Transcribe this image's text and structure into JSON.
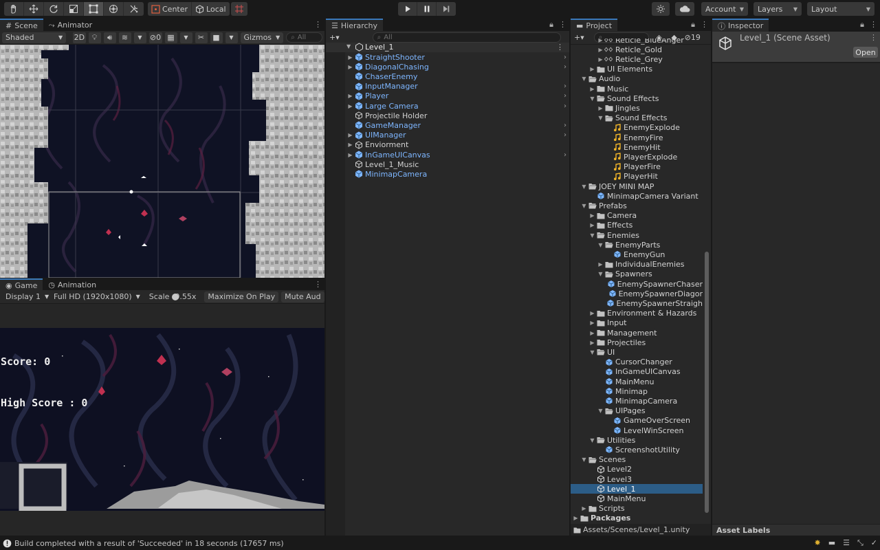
{
  "toolbar": {
    "pivot_label": "Center",
    "space_label": "Local",
    "account_label": "Account",
    "layers_label": "Layers",
    "layout_label": "Layout"
  },
  "scene_panel": {
    "tabs": [
      {
        "label": "Scene"
      },
      {
        "label": "Animator"
      }
    ],
    "shading_mode": "Shaded",
    "toggle_2d": "2D",
    "hidden_count": "0",
    "gizmos_label": "Gizmos",
    "search_placeholder": "All"
  },
  "game_panel": {
    "tabs": [
      {
        "label": "Game"
      },
      {
        "label": "Animation"
      }
    ],
    "display": "Display 1",
    "resolution": "Full HD (1920x1080)",
    "scale_label": "Scale",
    "scale_value": "0.55x",
    "maximize_label": "Maximize On Play",
    "mute_label": "Mute Aud",
    "score_text": "Score: 0",
    "high_score_text": "High Score : 0"
  },
  "hierarchy": {
    "tab_label": "Hierarchy",
    "search_placeholder": "All",
    "scene_name": "Level_1",
    "items": [
      {
        "label": "StraightShooter",
        "type": "prefab",
        "expandable": true
      },
      {
        "label": "DiagonalChasing",
        "type": "prefab",
        "expandable": true
      },
      {
        "label": "ChaserEnemy",
        "type": "prefab",
        "expandable": false
      },
      {
        "label": "InputManager",
        "type": "prefab",
        "expandable": false
      },
      {
        "label": "Player",
        "type": "prefab",
        "expandable": true
      },
      {
        "label": "Large Camera",
        "type": "prefab",
        "expandable": true
      },
      {
        "label": "Projectile Holder",
        "type": "object",
        "expandable": false
      },
      {
        "label": "GameManager",
        "type": "prefab",
        "expandable": false
      },
      {
        "label": "UIManager",
        "type": "prefab",
        "expandable": true
      },
      {
        "label": "Enviorment",
        "type": "object",
        "expandable": true
      },
      {
        "label": "InGameUICanvas",
        "type": "prefab",
        "expandable": true
      },
      {
        "label": "Level_1_Music",
        "type": "object",
        "expandable": false
      },
      {
        "label": "MinimapCamera",
        "type": "prefab",
        "expandable": false
      }
    ]
  },
  "project": {
    "tab_label": "Project",
    "hidden_packages_count": "19",
    "path": "Assets/Scenes/Level_1.unity",
    "items": [
      {
        "label": "Reticle_BlueAnger",
        "depth": 2,
        "icon": "sprite",
        "fold": "closed"
      },
      {
        "label": "Reticle_Gold",
        "depth": 2,
        "icon": "sprite",
        "fold": "closed"
      },
      {
        "label": "Reticle_Grey",
        "depth": 2,
        "icon": "sprite",
        "fold": "closed"
      },
      {
        "label": "UI Elements",
        "depth": 1,
        "icon": "folder",
        "fold": "closed"
      },
      {
        "label": "Audio",
        "depth": 0,
        "icon": "folder-open",
        "fold": "open"
      },
      {
        "label": "Music",
        "depth": 1,
        "icon": "folder",
        "fold": "closed"
      },
      {
        "label": "Sound Effects",
        "depth": 1,
        "icon": "folder-open",
        "fold": "open"
      },
      {
        "label": "Jingles",
        "depth": 2,
        "icon": "folder",
        "fold": "closed"
      },
      {
        "label": "Sound Effects",
        "depth": 2,
        "icon": "folder-open",
        "fold": "open"
      },
      {
        "label": "EnemyExplode",
        "depth": 3,
        "icon": "audio",
        "fold": "none"
      },
      {
        "label": "EnemyFire",
        "depth": 3,
        "icon": "audio",
        "fold": "none"
      },
      {
        "label": "EnemyHit",
        "depth": 3,
        "icon": "audio",
        "fold": "none"
      },
      {
        "label": "PlayerExplode",
        "depth": 3,
        "icon": "audio",
        "fold": "none"
      },
      {
        "label": "PlayerFire",
        "depth": 3,
        "icon": "audio",
        "fold": "none"
      },
      {
        "label": "PlayerHit",
        "depth": 3,
        "icon": "audio",
        "fold": "none"
      },
      {
        "label": "JOEY MINI MAP",
        "depth": 0,
        "icon": "folder-open",
        "fold": "open"
      },
      {
        "label": "MinimapCamera Variant",
        "depth": 1,
        "icon": "prefab",
        "fold": "none"
      },
      {
        "label": "Prefabs",
        "depth": 0,
        "icon": "folder-open",
        "fold": "open"
      },
      {
        "label": "Camera",
        "depth": 1,
        "icon": "folder",
        "fold": "closed"
      },
      {
        "label": "Effects",
        "depth": 1,
        "icon": "folder",
        "fold": "closed"
      },
      {
        "label": "Enemies",
        "depth": 1,
        "icon": "folder-open",
        "fold": "open"
      },
      {
        "label": "EnemyParts",
        "depth": 2,
        "icon": "folder-open",
        "fold": "open"
      },
      {
        "label": "EnemyGun",
        "depth": 3,
        "icon": "prefab",
        "fold": "none"
      },
      {
        "label": "IndividualEnemies",
        "depth": 2,
        "icon": "folder",
        "fold": "closed"
      },
      {
        "label": "Spawners",
        "depth": 2,
        "icon": "folder-open",
        "fold": "open"
      },
      {
        "label": "EnemySpawnerChaser",
        "depth": 3,
        "icon": "prefab",
        "fold": "none"
      },
      {
        "label": "EnemySpawnerDiagor",
        "depth": 3,
        "icon": "prefab",
        "fold": "none"
      },
      {
        "label": "EnemySpawnerStraigh",
        "depth": 3,
        "icon": "prefab",
        "fold": "none"
      },
      {
        "label": "Environment & Hazards",
        "depth": 1,
        "icon": "folder",
        "fold": "closed"
      },
      {
        "label": "Input",
        "depth": 1,
        "icon": "folder",
        "fold": "closed"
      },
      {
        "label": "Management",
        "depth": 1,
        "icon": "folder",
        "fold": "closed"
      },
      {
        "label": "Projectiles",
        "depth": 1,
        "icon": "folder",
        "fold": "closed"
      },
      {
        "label": "UI",
        "depth": 1,
        "icon": "folder-open",
        "fold": "open"
      },
      {
        "label": "CursorChanger",
        "depth": 2,
        "icon": "prefab",
        "fold": "none"
      },
      {
        "label": "InGameUICanvas",
        "depth": 2,
        "icon": "prefab",
        "fold": "none"
      },
      {
        "label": "MainMenu",
        "depth": 2,
        "icon": "prefab",
        "fold": "none"
      },
      {
        "label": "Minimap",
        "depth": 2,
        "icon": "prefab",
        "fold": "none"
      },
      {
        "label": "MinimapCamera",
        "depth": 2,
        "icon": "prefab",
        "fold": "none"
      },
      {
        "label": "UIPages",
        "depth": 2,
        "icon": "folder-open",
        "fold": "open"
      },
      {
        "label": "GameOverScreen",
        "depth": 3,
        "icon": "prefab",
        "fold": "none"
      },
      {
        "label": "LevelWinScreen",
        "depth": 3,
        "icon": "prefab",
        "fold": "none"
      },
      {
        "label": "Utilities",
        "depth": 1,
        "icon": "folder-open",
        "fold": "open"
      },
      {
        "label": "ScreenshotUtility",
        "depth": 2,
        "icon": "prefab",
        "fold": "none"
      },
      {
        "label": "Scenes",
        "depth": 0,
        "icon": "folder-open",
        "fold": "open"
      },
      {
        "label": "Level2",
        "depth": 1,
        "icon": "scene",
        "fold": "none"
      },
      {
        "label": "Level3",
        "depth": 1,
        "icon": "scene",
        "fold": "none"
      },
      {
        "label": "Level_1",
        "depth": 1,
        "icon": "scene",
        "fold": "none",
        "selected": true
      },
      {
        "label": "MainMenu",
        "depth": 1,
        "icon": "scene",
        "fold": "none"
      },
      {
        "label": "Scripts",
        "depth": 0,
        "icon": "folder",
        "fold": "closed"
      },
      {
        "label": "Packages",
        "depth": -1,
        "icon": "folder",
        "fold": "closed"
      }
    ]
  },
  "inspector": {
    "tab_label": "Inspector",
    "asset_title": "Level_1 (Scene Asset)",
    "open_button": "Open",
    "asset_labels": "Asset Labels"
  },
  "status_bar": {
    "message": "Build completed with a result of 'Succeeded' in 18 seconds (17657 ms)"
  }
}
